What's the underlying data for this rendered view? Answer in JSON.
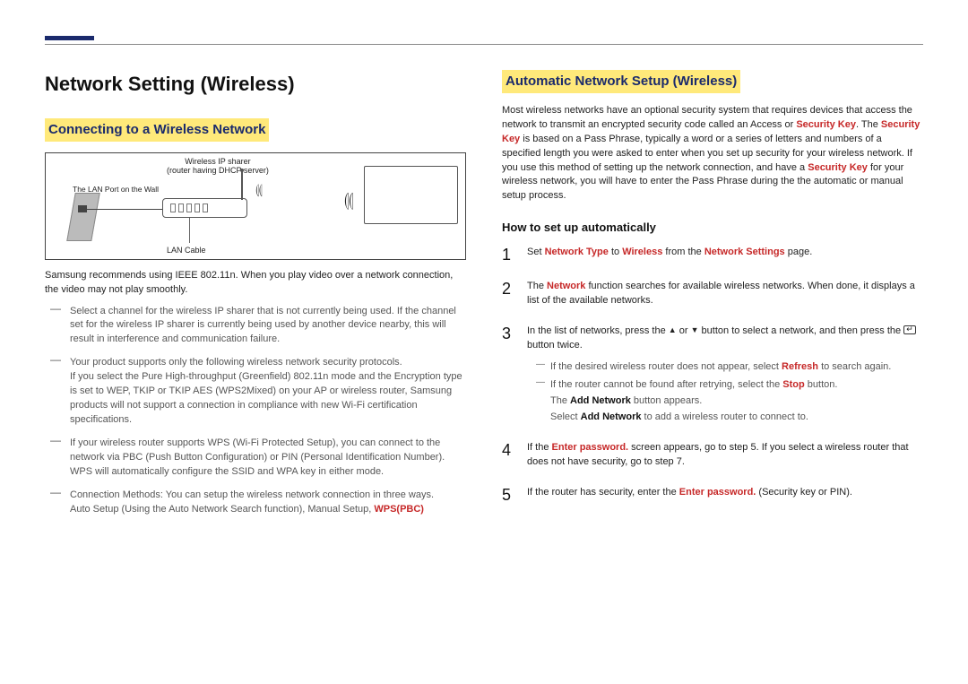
{
  "left": {
    "h1": "Network Setting (Wireless)",
    "h2": "Connecting to a Wireless Network",
    "diagram": {
      "top_label_line1": "Wireless IP sharer",
      "top_label_line2": "(router having DHCP server)",
      "wall_label": "The LAN Port on the Wall",
      "lan_label": "LAN Cable"
    },
    "recommend": "Samsung recommends using IEEE 802.11n. When you play video over a network connection, the video may not play smoothly.",
    "bullets": {
      "b1": "Select a channel for the wireless IP sharer that is not currently being used. If the channel set for the wireless IP sharer is currently being used by another device nearby, this will result in interference and communication failure.",
      "b2a": "Your product supports only the following wireless network security protocols.",
      "b2b": "If you select the Pure High-throughput (Greenfield) 802.11n mode and the Encryption type is set to WEP, TKIP or TKIP AES (WPS2Mixed) on your AP or wireless router, Samsung products will not support a connection in compliance with new Wi-Fi certification specifications.",
      "b3": "If your wireless router supports WPS (Wi-Fi Protected Setup), you can connect to the network via PBC (Push Button Configuration) or PIN (Personal Identification Number). WPS will automatically configure the SSID and WPA key in either mode.",
      "b4a": "Connection Methods: You can setup the wireless network connection in three ways.",
      "b4b_pre": "Auto Setup (Using the Auto Network Search function), Manual Setup, ",
      "b4b_red": "WPS(PBC)"
    }
  },
  "right": {
    "h2": "Automatic Network Setup (Wireless)",
    "intro": {
      "p1a": "Most wireless networks have an optional security system that requires devices that access the network to transmit an encrypted security code called an Access or ",
      "p1b": "Security Key",
      "p1c": ". The ",
      "p1d": "Security Key",
      "p1e": " is based on a Pass Phrase, typically a word or a series of letters and numbers of a specified length you were asked to enter when you set up security for your wireless network. If you use this method of setting up the network connection, and have a ",
      "p1f": "Security Key",
      "p1g": " for your wireless network, you will have to enter the Pass Phrase during the the automatic or manual setup process."
    },
    "h3": "How to set up automatically",
    "steps": {
      "s1": {
        "a": "Set ",
        "b": "Network Type",
        "c": " to ",
        "d": "Wireless",
        "e": " from the ",
        "f": "Network Settings",
        "g": " page."
      },
      "s2": {
        "a": "The ",
        "b": "Network",
        "c": " function searches for available wireless networks. When done, it displays a list of the available networks."
      },
      "s3": {
        "a": "In the list of networks, press the ",
        "b": " or ",
        "c": " button to select a network, and then press the ",
        "d": " button twice.",
        "sub1a": "If the desired wireless router does not appear, select ",
        "sub1b": "Refresh",
        "sub1c": " to search again.",
        "sub2a": "If the router cannot be found after retrying, select the ",
        "sub2b": "Stop",
        "sub2c": " button.",
        "line3a": "The ",
        "line3b": "Add Network",
        "line3c": " button appears.",
        "line4a": "Select ",
        "line4b": "Add Network",
        "line4c": " to add a wireless router to connect to."
      },
      "s4": {
        "a": "If the ",
        "b": "Enter password.",
        "c": " screen appears, go to step 5. If you select a wireless router that does not have security, go to step 7."
      },
      "s5": {
        "a": "If the router has security, enter the ",
        "b": "Enter password.",
        "c": " (Security key or PIN)."
      }
    }
  }
}
